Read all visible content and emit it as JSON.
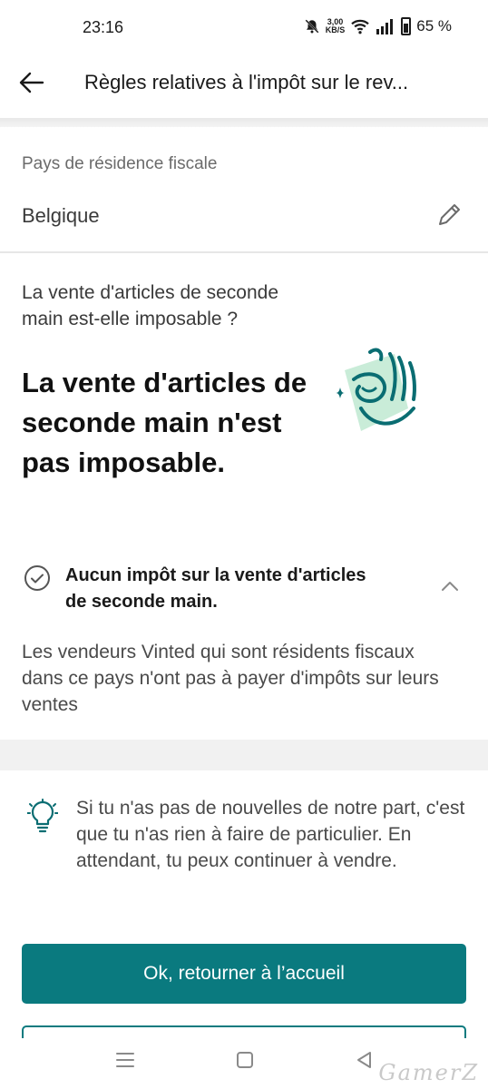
{
  "status_bar": {
    "time": "23:16",
    "speed_value": "3,00",
    "speed_unit": "KB/S",
    "battery": "65 %"
  },
  "header": {
    "title": "Règles relatives à l'impôt sur le rev..."
  },
  "residence": {
    "label": "Pays de résidence fiscale",
    "value": "Belgique"
  },
  "question": "La vente d'articles de seconde main est-elle imposable ?",
  "answer": "La vente d'articles de seconde main n'est pas imposable.",
  "accordion": {
    "title": "Aucun impôt sur la vente d'articles de seconde main.",
    "body": "Les vendeurs Vinted qui sont résidents fiscaux dans ce pays n'ont pas à payer d'impôts sur leurs ventes"
  },
  "tip": {
    "text": "Si tu n'as pas de nouvelles de notre part, c'est que tu n'as rien à faire de particulier. En attendant, tu peux continuer à vendre."
  },
  "primary_button": "Ok, retourner à l’accueil",
  "watermark": "GamerZ",
  "colors": {
    "accent": "#0a7a7f",
    "illustration_bg": "#c9ecd8"
  }
}
